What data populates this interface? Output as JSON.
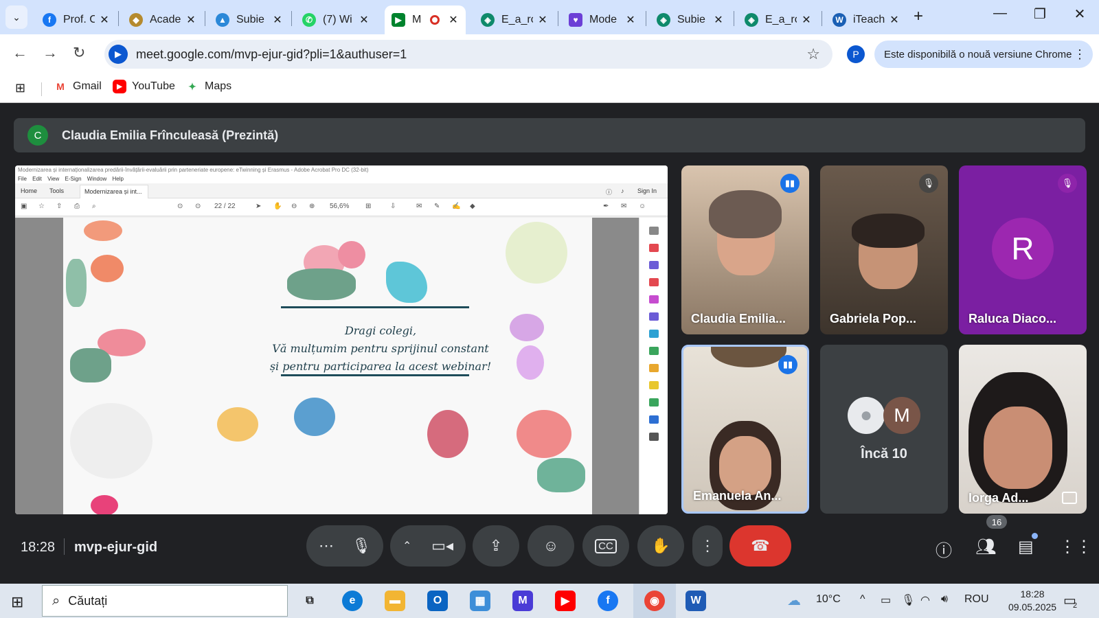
{
  "browser": {
    "tabs": [
      {
        "title": "Prof. C",
        "icon_color": "#1877f2",
        "icon_glyph": "f",
        "icon": "facebook-icon"
      },
      {
        "title": "Acade",
        "icon_color": "#b58a2e",
        "icon_glyph": "◆",
        "icon": "academy-crest-icon"
      },
      {
        "title": "Subie",
        "icon_color": "#2b88d8",
        "icon_glyph": "▲",
        "icon": "graduation-cap-icon"
      },
      {
        "title": "(7) Wi",
        "icon_color": "#25d366",
        "icon_glyph": "✆",
        "icon": "whatsapp-icon"
      },
      {
        "title": "M",
        "icon_color": "#00832d",
        "icon_glyph": "▶",
        "icon": "google-meet-icon",
        "active": true
      },
      {
        "title": "E_a_ro",
        "icon_color": "#0f8a6b",
        "icon_glyph": "◈",
        "icon": "chatgpt-icon"
      },
      {
        "title": "Mode",
        "icon_color": "#6c3fd6",
        "icon_glyph": "♥",
        "icon": "heart-chat-icon"
      },
      {
        "title": "Subie",
        "icon_color": "#0f8a6b",
        "icon_glyph": "◈",
        "icon": "chatgpt-icon"
      },
      {
        "title": "E_a_ro",
        "icon_color": "#0f8a6b",
        "icon_glyph": "◈",
        "icon": "chatgpt-icon"
      },
      {
        "title": "iTeach",
        "icon_color": "#1a5fb4",
        "icon_glyph": "W",
        "icon": "iteach-icon"
      }
    ],
    "url": "meet.google.com/mvp-ejur-gid?pli=1&authuser=1",
    "profile_initial": "P",
    "update_text": "Este disponibilă o nouă versiune Chrome",
    "bookmarks": [
      {
        "label": "Gmail",
        "icon": "gmail-icon"
      },
      {
        "label": "YouTube",
        "icon": "youtube-icon"
      },
      {
        "label": "Maps",
        "icon": "maps-icon"
      }
    ]
  },
  "meet": {
    "presenter_initial": "C",
    "presenter_label": "Claudia Emilia Frînculeasă (Prezintă)",
    "shared_screen": {
      "window_title": "Modernizarea și internaționalizarea  predării-învățării-evaluării  prin parteneriate europene: eTwinning și Erasmus - Adobe Acrobat Pro DC (32-bit)",
      "menu": "File  Edit  View  E-Sign  Window  Help",
      "tab_home": "Home",
      "tab_tools": "Tools",
      "doc_tab": "Modernizarea și int...",
      "sign_in": "Sign In",
      "page_indicator": "22 / 22",
      "zoom": "56,6%",
      "card_lines": [
        "Dragi colegi,",
        "Vă mulțumim pentru sprijinul constant",
        "și pentru participarea la acest webinar!"
      ]
    },
    "participants": [
      {
        "name": "Claudia Emilia...",
        "state": "speaking"
      },
      {
        "name": "Gabriela Pop...",
        "state": "muted"
      },
      {
        "name": "Raluca Diaco...",
        "state": "muted",
        "initial": "R",
        "color": "#8e24aa"
      },
      {
        "name": "Emanuela An...",
        "state": "speaking"
      },
      {
        "name": "Încă 10",
        "state": "overflow",
        "initial": "M"
      },
      {
        "name": "Iorga Ad...",
        "state": "none"
      }
    ],
    "time": "18:28",
    "meeting_code": "mvp-ejur-gid",
    "people_count": "16"
  },
  "taskbar": {
    "search_placeholder": "Căutați",
    "weather": "10°C",
    "language": "ROU",
    "time": "18:28",
    "date": "09.05.2025",
    "notifications": "2"
  }
}
